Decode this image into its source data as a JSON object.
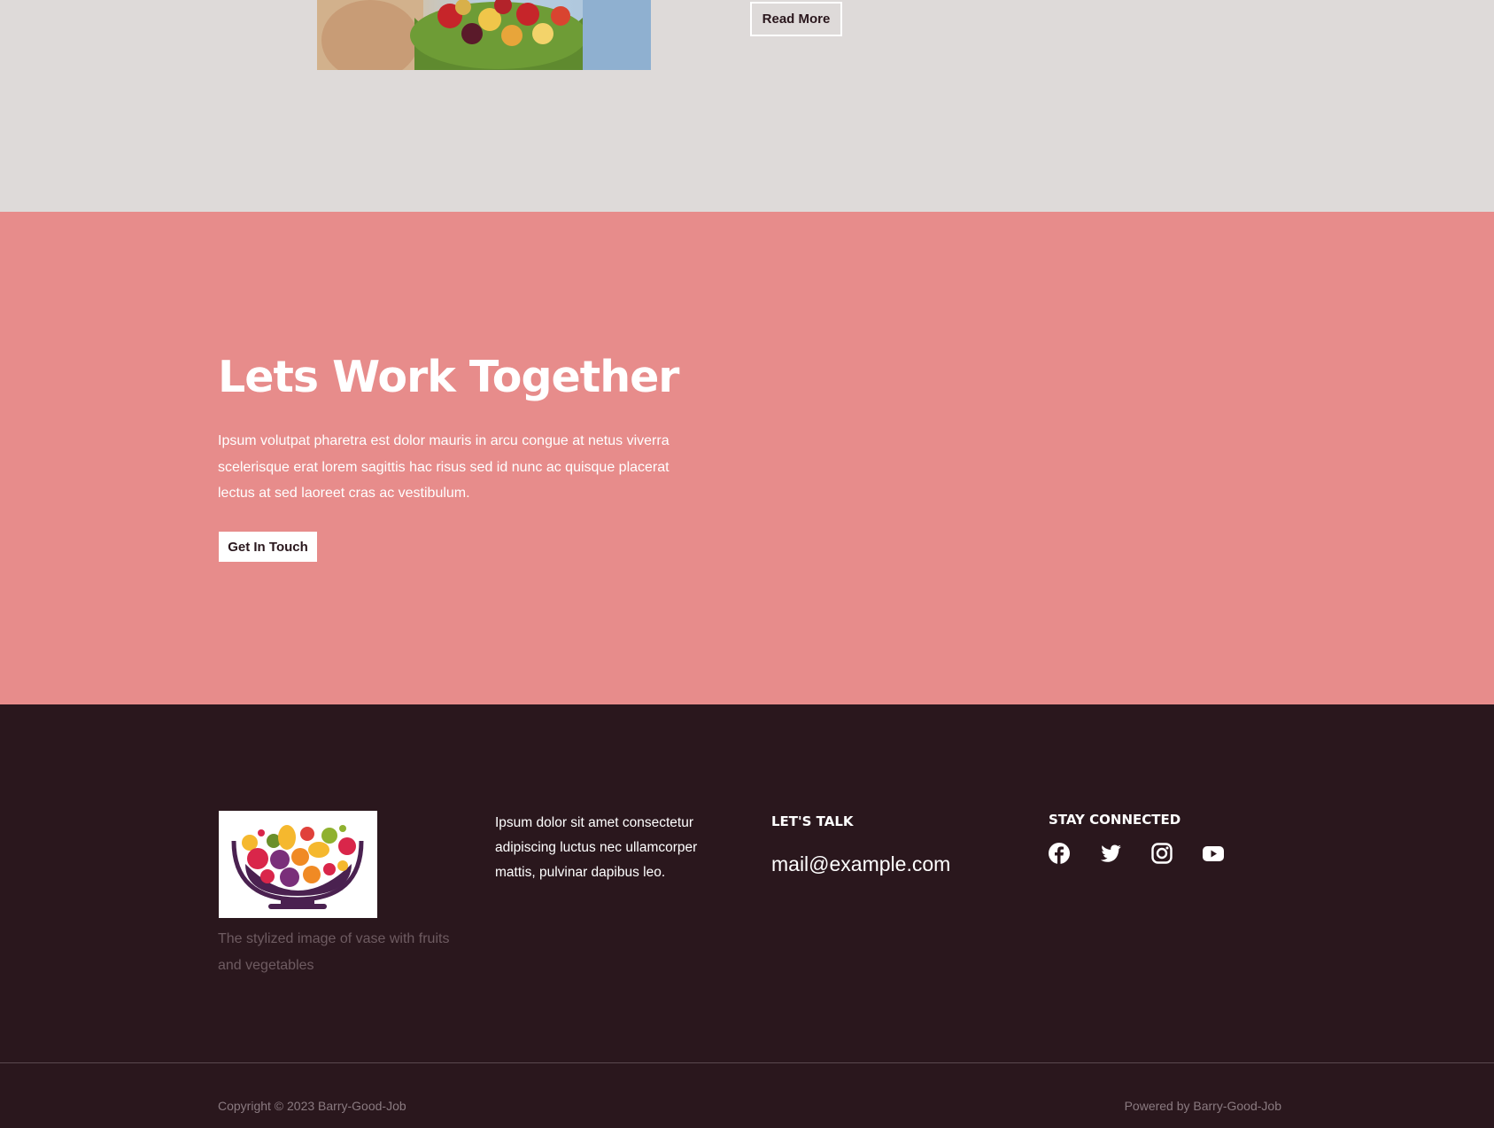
{
  "featured": {
    "image_alt": "fruit bowl photo",
    "read_more_label": "Read More"
  },
  "cta": {
    "title": "Lets Work Together",
    "text": "Ipsum volutpat pharetra est dolor mauris in arcu congue at netus viverra scelerisque erat lorem sagittis hac risus sed id nunc ac quisque placerat lectus at sed laoreet cras ac vestibulum.",
    "button_label": "Get In Touch"
  },
  "footer": {
    "logo_caption": "The stylized image of vase with fruits and vegetables",
    "about_text": "Ipsum dolor sit amet consectetur adipiscing luctus nec ullamcorper mattis, pulvinar dapibus leo.",
    "talk_heading": "LET'S TALK",
    "email": "mail@example.com",
    "connect_heading": "STAY CONNECTED",
    "social_icons": [
      "facebook-icon",
      "twitter-icon",
      "instagram-icon",
      "youtube-icon"
    ]
  },
  "bottom": {
    "copyright": "Copyright © 2023 Barry-Good-Job",
    "powered_by": "Powered by Barry-Good-Job"
  },
  "colors": {
    "top_bg": "#dedad9",
    "cta_bg": "#e78c8b",
    "footer_bg": "#2a171d",
    "logo_purple": "#4a2150"
  }
}
